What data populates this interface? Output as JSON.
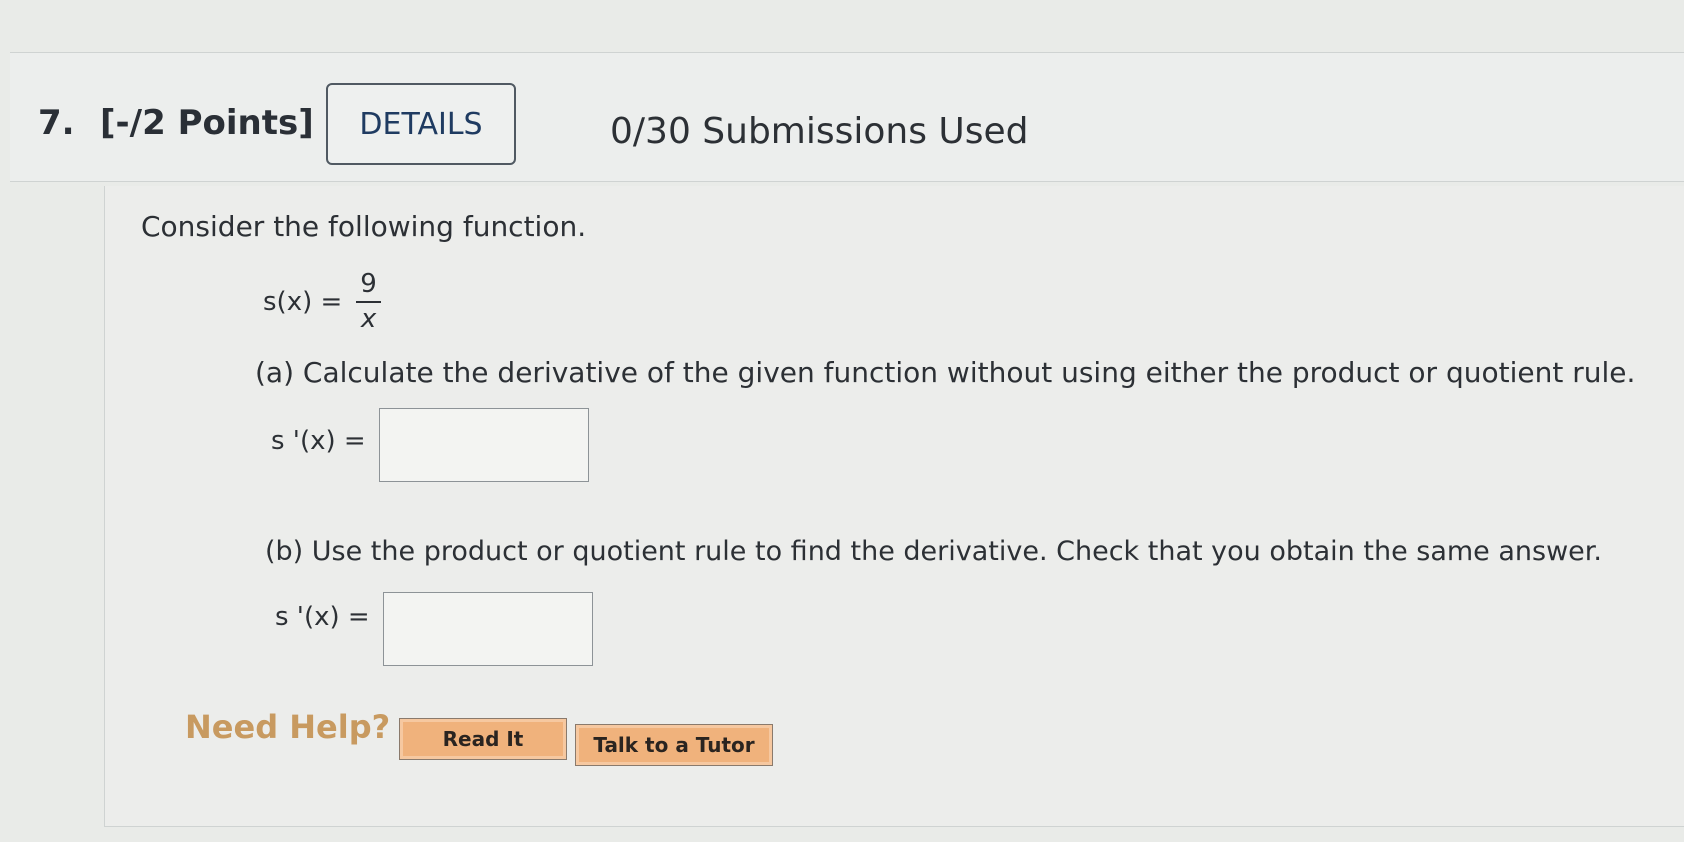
{
  "header": {
    "number": "7.",
    "points": "[-/2 Points]",
    "details_label": "DETAILS",
    "submissions": "0/30 Submissions Used"
  },
  "question": {
    "prompt": "Consider the following function.",
    "function_lhs": "s(x) =",
    "function_numerator": "9",
    "function_denominator": "x",
    "part_a": "(a) Calculate the derivative of the given function without using either the product or quotient rule.",
    "part_a_label": "s '(x) =",
    "part_a_value": "",
    "part_b": "(b) Use the product or quotient rule to find the derivative. Check that you obtain the same answer.",
    "part_b_label": "s '(x) =",
    "part_b_value": ""
  },
  "help": {
    "label": "Need Help?",
    "read_it": "Read It",
    "talk_to_tutor": "Talk to a Tutor"
  },
  "colors": {
    "details_text": "#1f3b61",
    "need_help": "#c89a60",
    "help_button": "#f0b27c"
  }
}
